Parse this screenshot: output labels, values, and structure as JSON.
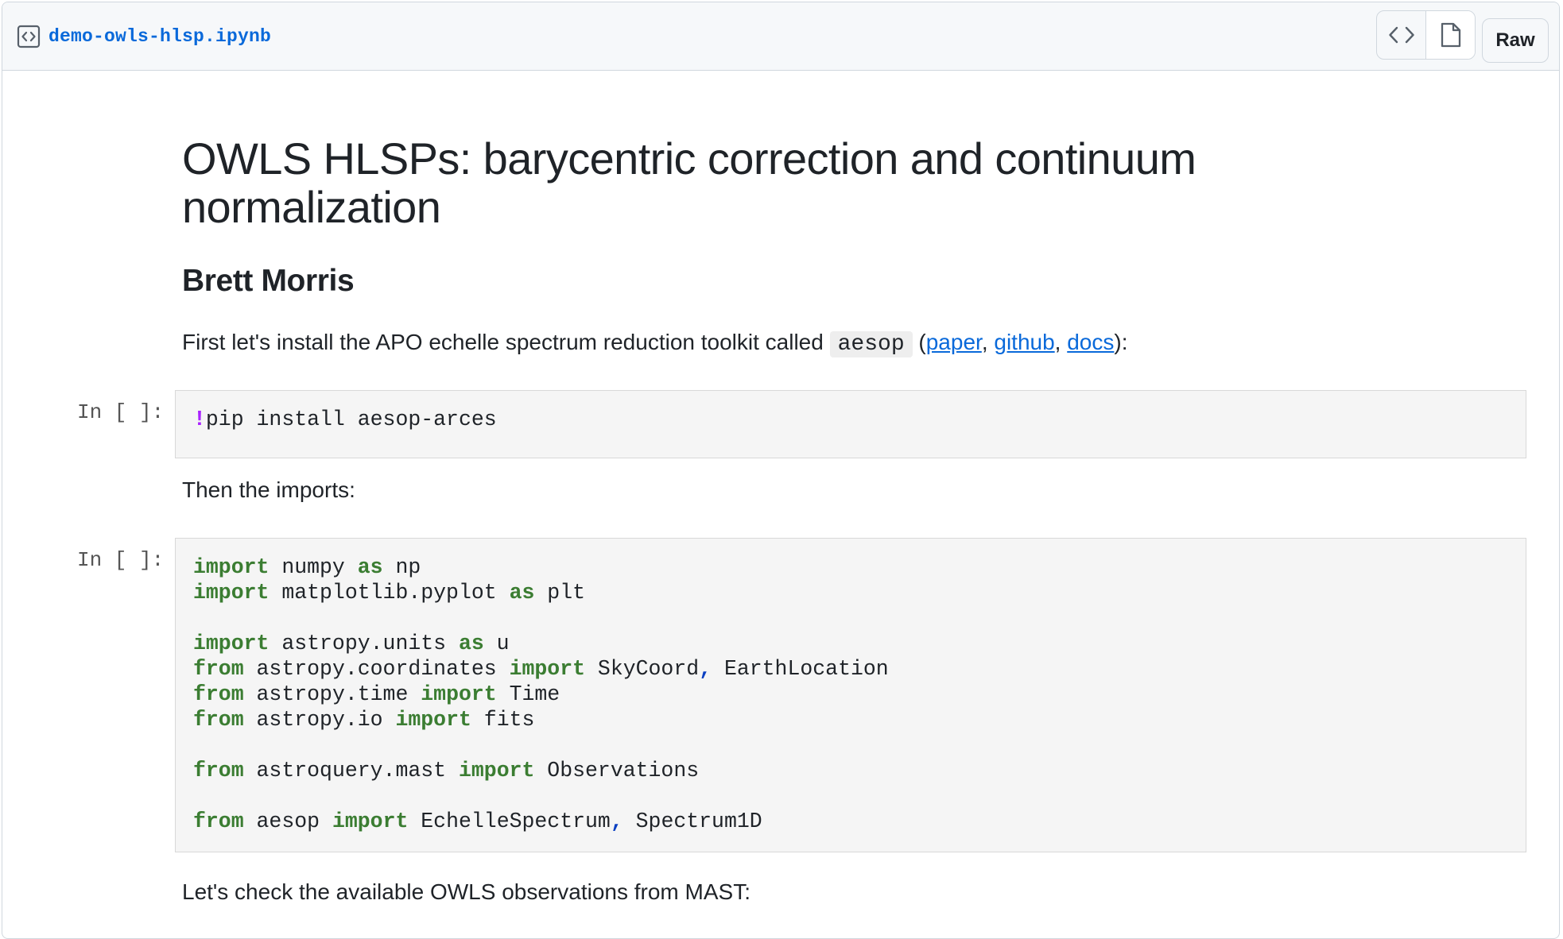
{
  "file": {
    "name": "demo-owls-hlsp.ipynb",
    "icon": "file-code-icon"
  },
  "toolbar": {
    "code_view_icon": "code-icon",
    "preview_icon": "file-icon",
    "raw_label": "Raw"
  },
  "notebook": {
    "title": "OWLS HLSPs: barycentric correction and continuum normalization",
    "author": "Brett Morris",
    "intro": {
      "before": "First let's install the APO echelle spectrum reduction toolkit called",
      "code": "aesop",
      "open": "(",
      "links": [
        "paper",
        "github",
        "docs"
      ],
      "sep": ", ",
      "close": "):"
    },
    "cells": [
      {
        "prompt": "In [ ]:",
        "lines": [
          [
            {
              "t": "!",
              "c": "op"
            },
            {
              "t": "pip install aesop-arces"
            }
          ]
        ]
      },
      {
        "prompt": "In [ ]:",
        "lines": [
          [
            {
              "t": "import",
              "c": "kw"
            },
            {
              "t": " numpy "
            },
            {
              "t": "as",
              "c": "kw"
            },
            {
              "t": " np"
            }
          ],
          [
            {
              "t": "import",
              "c": "kw"
            },
            {
              "t": " matplotlib.pyplot "
            },
            {
              "t": "as",
              "c": "kw"
            },
            {
              "t": " plt"
            }
          ],
          [],
          [
            {
              "t": "import",
              "c": "kw"
            },
            {
              "t": " astropy.units "
            },
            {
              "t": "as",
              "c": "kw"
            },
            {
              "t": " u"
            }
          ],
          [
            {
              "t": "from",
              "c": "kw"
            },
            {
              "t": " astropy.coordinates "
            },
            {
              "t": "import",
              "c": "kw"
            },
            {
              "t": " SkyCoord"
            },
            {
              "t": ",",
              "c": "pn"
            },
            {
              "t": " EarthLocation"
            }
          ],
          [
            {
              "t": "from",
              "c": "kw"
            },
            {
              "t": " astropy.time "
            },
            {
              "t": "import",
              "c": "kw"
            },
            {
              "t": " Time"
            }
          ],
          [
            {
              "t": "from",
              "c": "kw"
            },
            {
              "t": " astropy.io "
            },
            {
              "t": "import",
              "c": "kw"
            },
            {
              "t": " fits"
            }
          ],
          [],
          [
            {
              "t": "from",
              "c": "kw"
            },
            {
              "t": " astroquery.mast "
            },
            {
              "t": "import",
              "c": "kw"
            },
            {
              "t": " Observations"
            }
          ],
          [],
          [
            {
              "t": "from",
              "c": "kw"
            },
            {
              "t": " aesop "
            },
            {
              "t": "import",
              "c": "kw"
            },
            {
              "t": " EchelleSpectrum"
            },
            {
              "t": ",",
              "c": "pn"
            },
            {
              "t": " Spectrum1D"
            }
          ]
        ]
      }
    ],
    "text_then_imports": "Then the imports:",
    "text_check_mast": "Let's check the available OWLS observations from MAST:"
  }
}
